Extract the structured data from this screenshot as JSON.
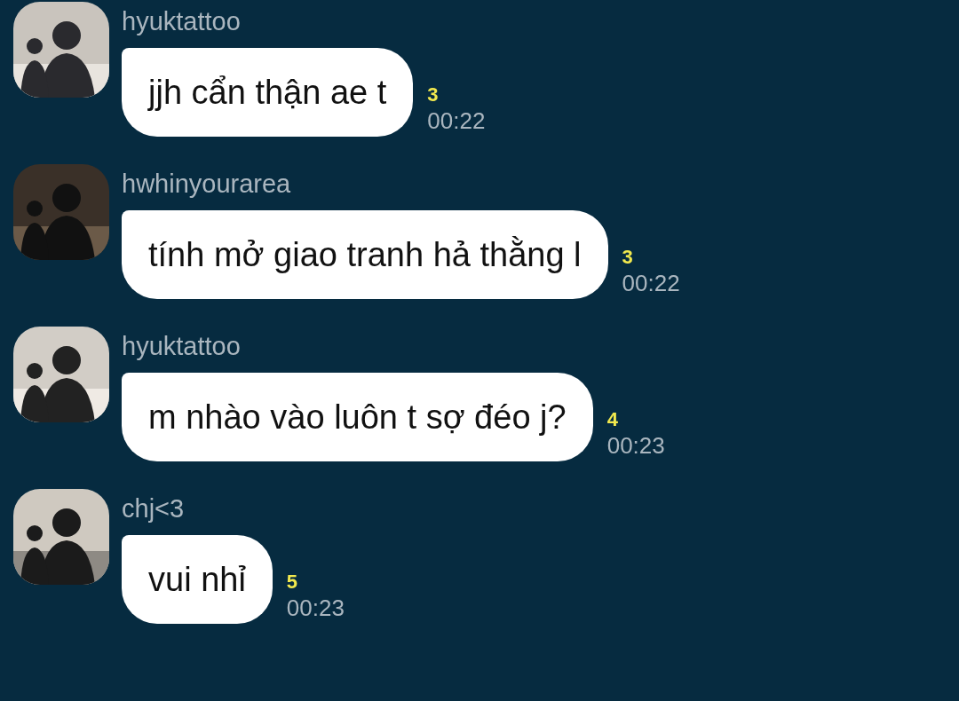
{
  "messages": [
    {
      "sender": "hyuktattoo",
      "text": "jjh cẩn thận ae t",
      "count": "3",
      "time": "00:22"
    },
    {
      "sender": "hwhinyourarea",
      "text": "tính mở giao tranh hả thằng l",
      "count": "3",
      "time": "00:22"
    },
    {
      "sender": "hyuktattoo",
      "text": "m nhào vào luôn t sợ đéo j?",
      "count": "4",
      "time": "00:23"
    },
    {
      "sender": "chj<3",
      "text": "vui nhỉ",
      "count": "5",
      "time": "00:23"
    }
  ]
}
